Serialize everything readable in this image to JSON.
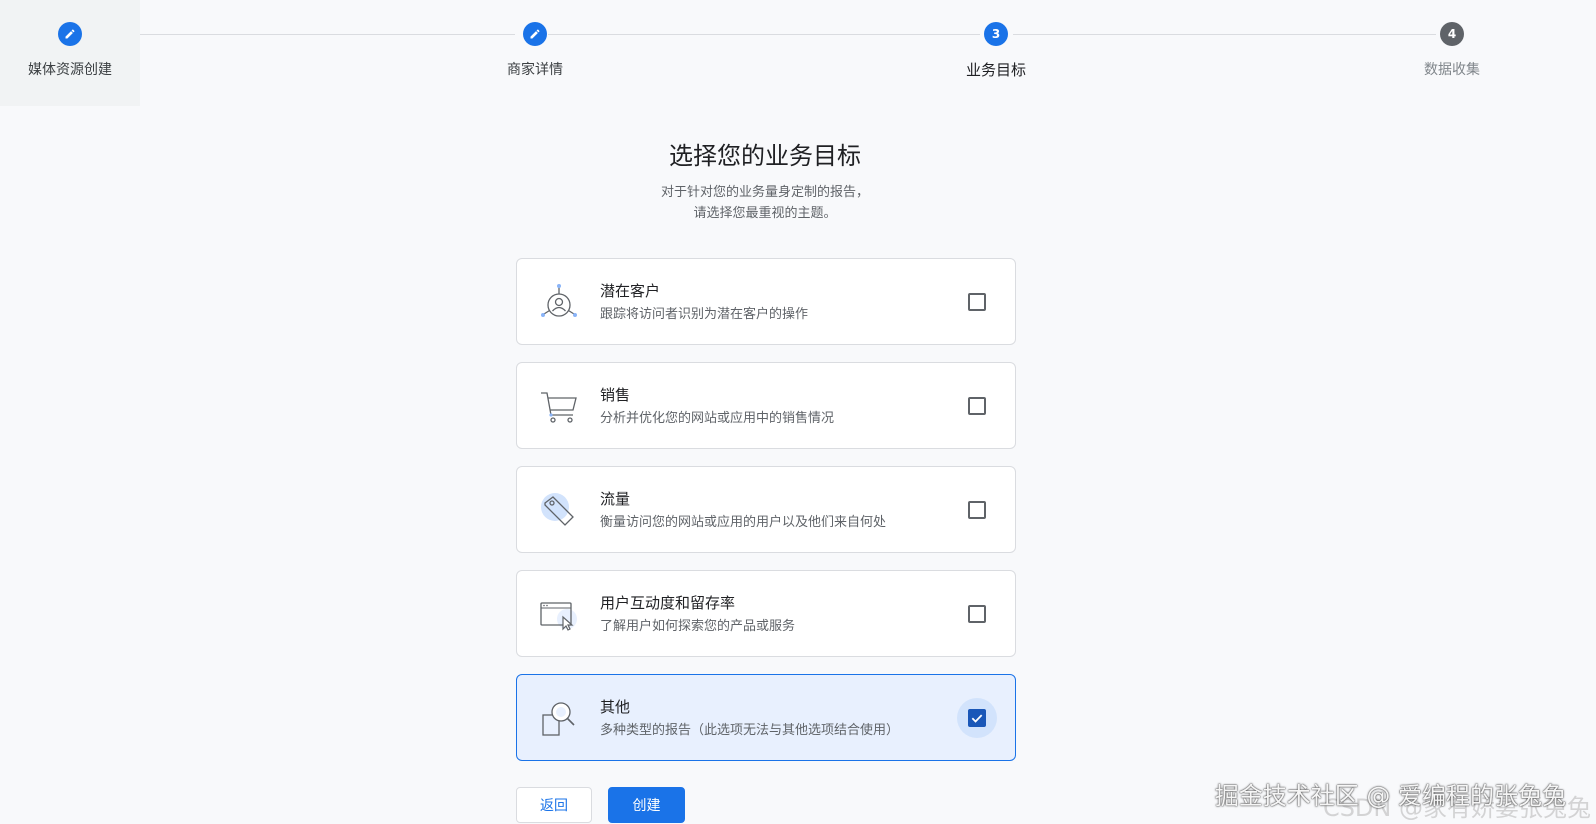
{
  "stepper": {
    "steps": [
      {
        "label": "媒体资源创建",
        "number": "",
        "state": "done"
      },
      {
        "label": "商家详情",
        "number": "",
        "state": "done"
      },
      {
        "label": "业务目标",
        "number": "3",
        "state": "current"
      },
      {
        "label": "数据收集",
        "number": "4",
        "state": "pending"
      }
    ]
  },
  "header": {
    "title": "选择您的业务目标",
    "subtitle_line1": "对于针对您的业务量身定制的报告，",
    "subtitle_line2": "请选择您最重视的主题。"
  },
  "options": [
    {
      "title": "潜在客户",
      "desc": "跟踪将访问者识别为潜在客户的操作",
      "icon": "leads-icon",
      "checked": false
    },
    {
      "title": "销售",
      "desc": "分析并优化您的网站或应用中的销售情况",
      "icon": "cart-icon",
      "checked": false
    },
    {
      "title": "流量",
      "desc": "衡量访问您的网站或应用的用户以及他们来自何处",
      "icon": "tag-icon",
      "checked": false
    },
    {
      "title": "用户互动度和留存率",
      "desc": "了解用户如何探索您的产品或服务",
      "icon": "screen-cursor-icon",
      "checked": false
    },
    {
      "title": "其他",
      "desc": "多种类型的报告（此选项无法与其他选项结合使用）",
      "icon": "magnifier-icon",
      "checked": true
    }
  ],
  "buttons": {
    "back": "返回",
    "create": "创建"
  },
  "watermark": {
    "text": "掘金技术社区 @ 爱编程的张兔兔",
    "text2": "CSDN @家有娇妻张兔兔"
  },
  "colors": {
    "accent": "#1a73e8",
    "selected_bg": "#e8f0fe"
  }
}
